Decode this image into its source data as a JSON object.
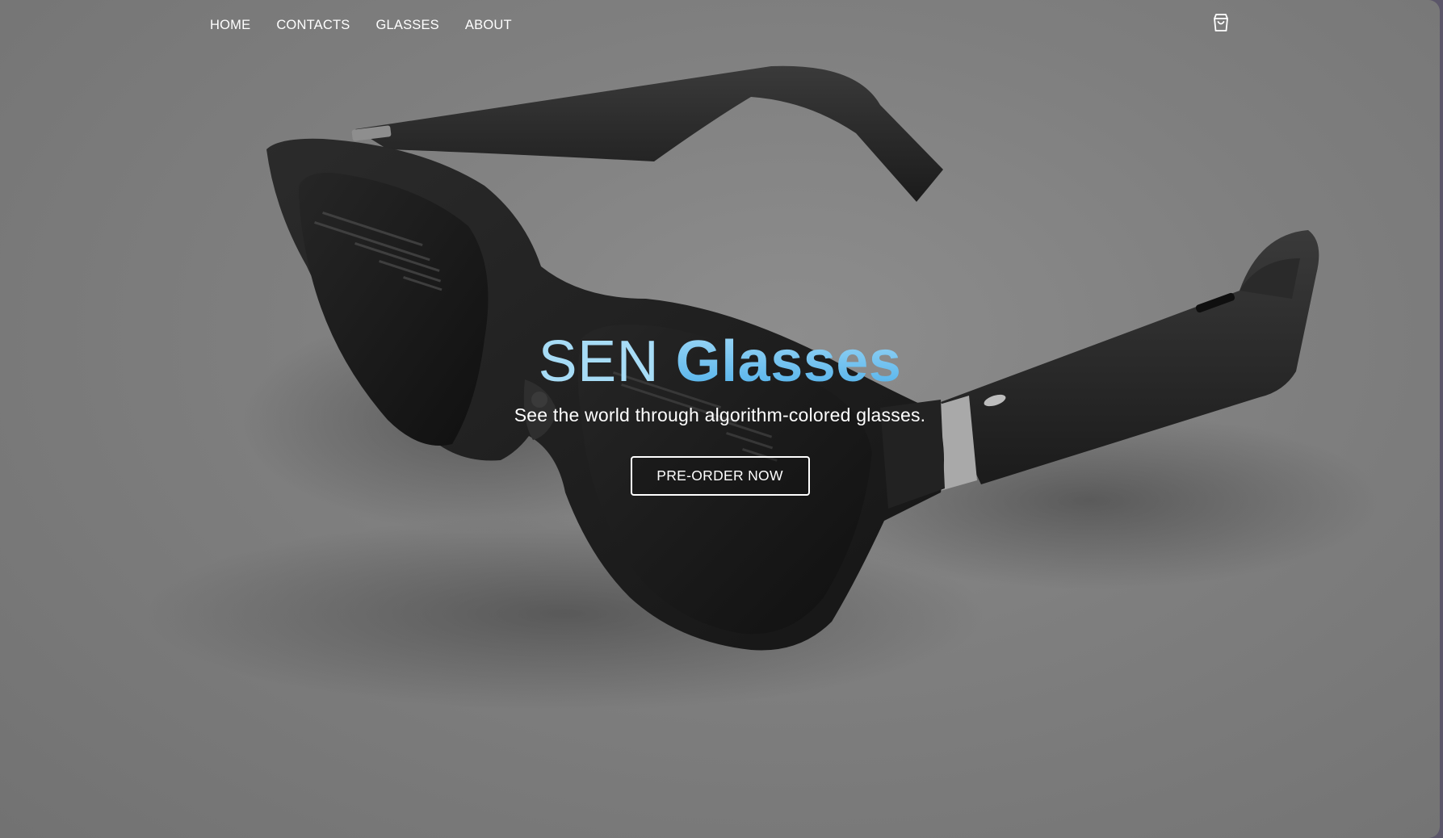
{
  "nav": {
    "items": [
      {
        "label": "HOME"
      },
      {
        "label": "CONTACTS"
      },
      {
        "label": "GLASSES"
      },
      {
        "label": "ABOUT"
      }
    ],
    "cart_icon": "shopping-bag-icon"
  },
  "hero": {
    "title_part1": "SEN",
    "title_part2": "Glasses",
    "subtitle": "See the world through algorithm-colored glasses.",
    "cta_label": "PRE-ORDER NOW"
  },
  "colors": {
    "background": "#7f7f7f",
    "title_light": "#a7dcf6",
    "title_accent": "#6cc0ee",
    "text": "#ffffff"
  }
}
